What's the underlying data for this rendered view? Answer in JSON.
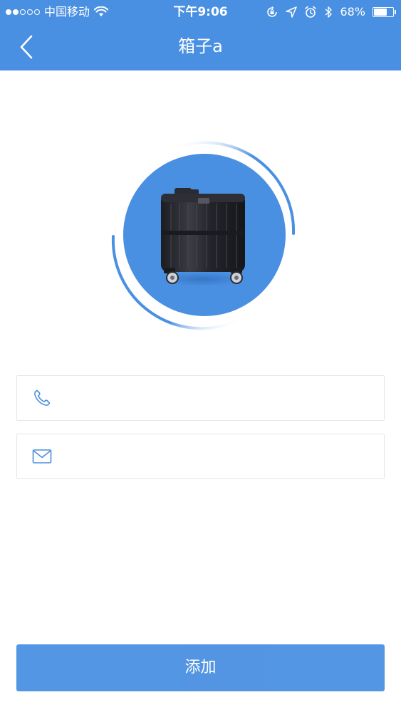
{
  "colors": {
    "accent": "#4a90e2",
    "accent_light": "#7bb3ff",
    "white": "#ffffff",
    "border": "#e6e6e6",
    "icon": "#4a8fd9"
  },
  "status_bar": {
    "carrier": "中国移动",
    "time": "下午9:06",
    "battery": "68%",
    "battery_level": 0.68,
    "signal_dots_filled": 2,
    "signal_dots_total": 5,
    "icons": [
      "wifi-icon",
      "orientation-lock-icon",
      "location-icon",
      "alarm-icon",
      "bluetooth-icon",
      "battery-icon"
    ]
  },
  "nav": {
    "title": "箱子a",
    "back_icon": "chevron-left-icon"
  },
  "hero": {
    "image": "suitcase"
  },
  "form": {
    "phone": {
      "icon": "phone-icon",
      "value": "",
      "placeholder": ""
    },
    "email": {
      "icon": "mail-icon",
      "value": "",
      "placeholder": ""
    }
  },
  "actions": {
    "add_label": "添加"
  }
}
